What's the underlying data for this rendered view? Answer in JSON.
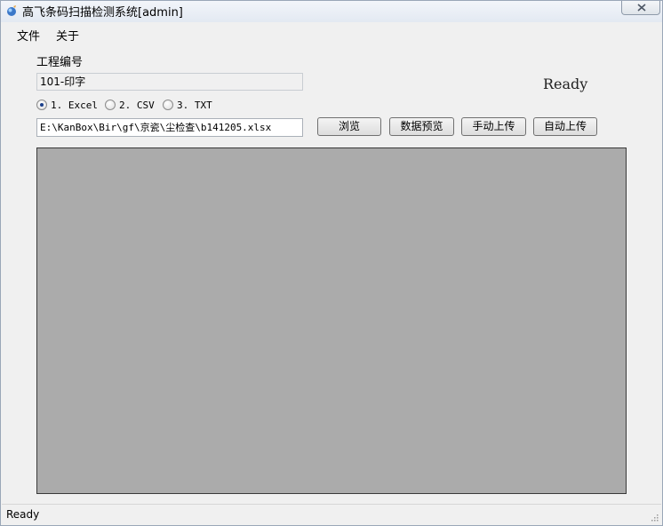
{
  "window": {
    "title": "高飞条码扫描检测系统[admin]"
  },
  "menu": {
    "items": [
      {
        "label": "文件"
      },
      {
        "label": "关于"
      }
    ]
  },
  "form": {
    "project_label": "工程编号",
    "project_value": "101-印字",
    "ready_text": "Ready",
    "radio_options": [
      {
        "label": "1. Excel",
        "checked": true
      },
      {
        "label": "2. CSV",
        "checked": false
      },
      {
        "label": "3. TXT",
        "checked": false
      }
    ],
    "file_path": "E:\\KanBox\\Bir\\gf\\京瓷\\尘检查\\b141205.xlsx",
    "buttons": {
      "browse": "浏览",
      "preview": "数据预览",
      "manual_upload": "手动上传",
      "auto_upload": "自动上传"
    }
  },
  "status": {
    "text": "Ready"
  },
  "colors": {
    "grid_background": "#ababab",
    "window_background": "#f0f0f0"
  }
}
